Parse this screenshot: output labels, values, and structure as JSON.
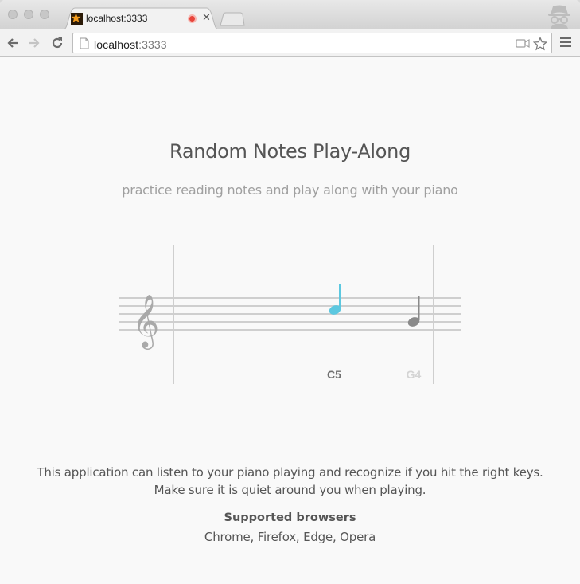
{
  "browser": {
    "tab": {
      "title": "localhost:3333"
    },
    "address": {
      "host": "localhost",
      "port": ":3333"
    }
  },
  "page": {
    "title": "Random Notes Play-Along",
    "subtitle": "practice reading notes and play along with your piano",
    "staff": {
      "clef": "treble",
      "notes": [
        {
          "label": "C5",
          "active": true,
          "color": "#5cc8e0"
        },
        {
          "label": "G4",
          "active": false,
          "color": "#8a8a8a"
        }
      ]
    },
    "description_line1": "This application can listen to your piano playing and recognize if you hit the right keys.",
    "description_line2": "Make sure it is quiet around you when playing.",
    "supported_title": "Supported browsers",
    "supported_list": "Chrome, Firefox, Edge, Opera"
  },
  "colors": {
    "accent": "#5cc8e0",
    "text": "#555555",
    "muted": "#a0a0a0"
  }
}
